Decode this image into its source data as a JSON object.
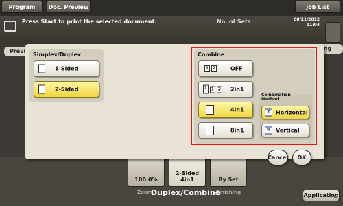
{
  "header": {
    "tabs": [
      {
        "label": "Program"
      },
      {
        "label": "Doc. Preview"
      },
      {
        "label": "Job List"
      }
    ],
    "message": "Press Start to print the selected document.",
    "sets_label": "No. of Sets",
    "date": "08/21/2012",
    "time": "11:04"
  },
  "background": {
    "left_tab": "Previ",
    "right_tab": "etting",
    "function_buttons": [
      {
        "label": "100.0%",
        "caption": "Zoom"
      },
      {
        "label": "2-Sided\n4in1",
        "caption": ""
      },
      {
        "label": "By Set",
        "caption": "Finishing"
      }
    ],
    "section_title": "Duplex/Combine",
    "application_button": "Application"
  },
  "dialog": {
    "simplex_duplex": {
      "title": "Simplex/Duplex",
      "options": [
        {
          "label": "1-Sided",
          "selected": false
        },
        {
          "label": "2-Sided",
          "selected": true
        }
      ]
    },
    "combine": {
      "title": "Combine",
      "options": [
        {
          "label": "OFF",
          "selected": false
        },
        {
          "label": "2in1",
          "selected": false
        },
        {
          "label": "4in1",
          "selected": true
        },
        {
          "label": "8in1",
          "selected": false
        }
      ],
      "method": {
        "title_line1": "Combination",
        "title_line2": "Method",
        "options": [
          {
            "label": "Horizontal",
            "selected": true
          },
          {
            "label": "Vertical",
            "selected": false
          }
        ]
      }
    },
    "cancel_label": "Cancel",
    "ok_label": "OK"
  },
  "colors": {
    "selected": "#f0d640",
    "highlight": "#e11818",
    "dialog_bg": "#e8e3d4"
  }
}
